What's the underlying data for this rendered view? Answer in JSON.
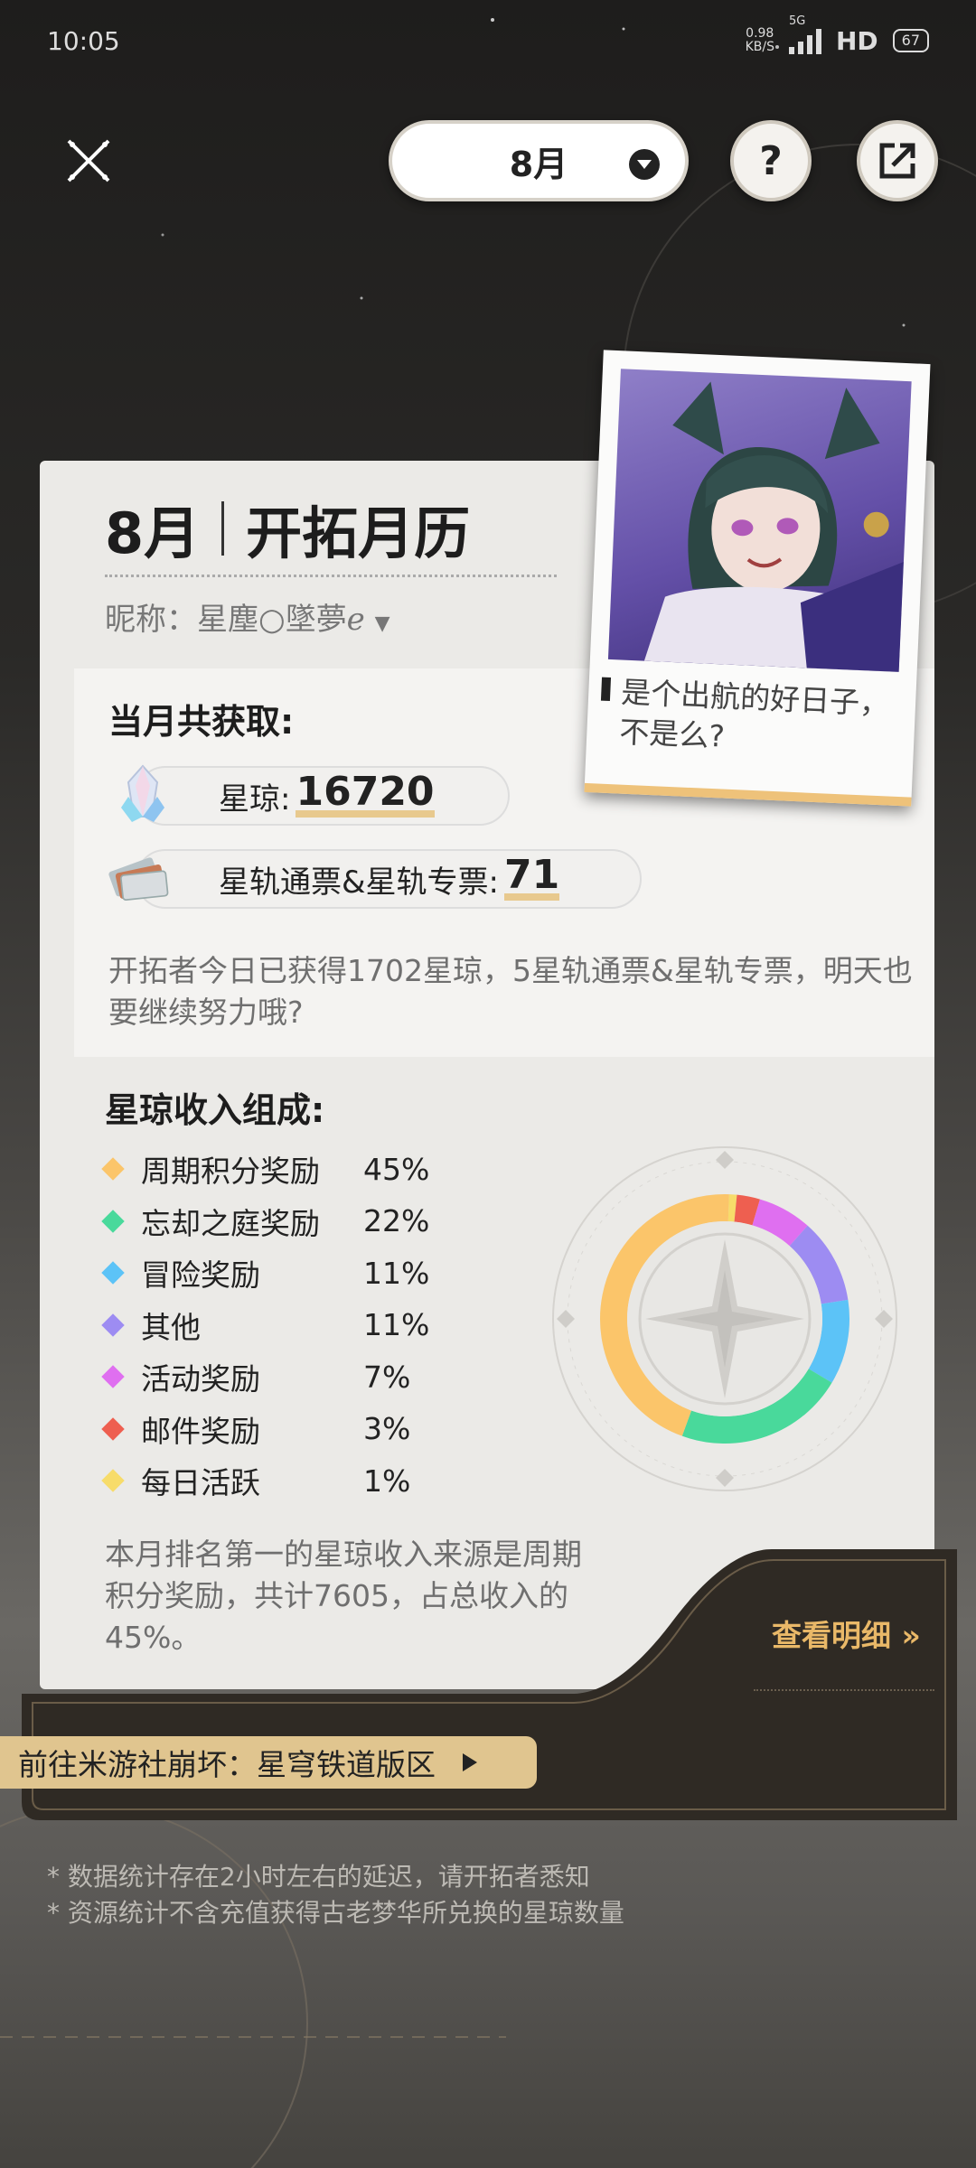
{
  "status_bar": {
    "time": "10:05",
    "net_speed": "0.98",
    "net_unit": "KB/S",
    "network": "5G",
    "hd": "HD",
    "battery": "67"
  },
  "header": {
    "month_select": "8月",
    "help_label": "?"
  },
  "card": {
    "title_month": "8月",
    "title_name": "开拓月历",
    "nickname_label": "昵称：",
    "nickname_value": "星塵○墜夢ℯ"
  },
  "photo": {
    "caption": "是个出航的好日子，不是么?"
  },
  "earnings": {
    "heading": "当月共获取:",
    "jade_label": "星琼:",
    "jade_value": "16720",
    "pass_label": "星轨通票&星轨专票:",
    "pass_value": "71",
    "note": "开拓者今日已获得1702星琼，5星轨通票&星轨专票，明天也要继续努力哦?"
  },
  "composition": {
    "heading": "星琼收入组成:",
    "items": [
      {
        "label": "周期积分奖励",
        "pct": "45%",
        "color": "#fbc56a"
      },
      {
        "label": "忘却之庭奖励",
        "pct": "22%",
        "color": "#49d99b"
      },
      {
        "label": "冒险奖励",
        "pct": "11%",
        "color": "#5cc3f7"
      },
      {
        "label": "其他",
        "pct": "11%",
        "color": "#9d8cf2"
      },
      {
        "label": "活动奖励",
        "pct": "7%",
        "color": "#df6ff0"
      },
      {
        "label": "邮件奖励",
        "pct": "3%",
        "color": "#ee5f50"
      },
      {
        "label": "每日活跃",
        "pct": "1%",
        "color": "#f7dc6a"
      }
    ],
    "summary": "本月排名第一的星琼收入来源是周期积分奖励，共计7605，占总收入的45%。"
  },
  "chart_data": {
    "type": "pie",
    "categories": [
      "周期积分奖励",
      "忘却之庭奖励",
      "冒险奖励",
      "其他",
      "活动奖励",
      "邮件奖励",
      "每日活跃"
    ],
    "values": [
      45,
      22,
      11,
      11,
      7,
      3,
      1
    ],
    "colors": [
      "#fbc56a",
      "#49d99b",
      "#5cc3f7",
      "#9d8cf2",
      "#df6ff0",
      "#ee5f50",
      "#f7dc6a"
    ]
  },
  "actions": {
    "detail_label": "查看明细 »",
    "forum_label": "前往米游社崩坏：星穹铁道版区"
  },
  "footnotes": [
    "* 数据统计存在2小时左右的延迟，请开拓者悉知",
    "* 资源统计不含充值获得古老梦华所兑换的星琼数量"
  ]
}
